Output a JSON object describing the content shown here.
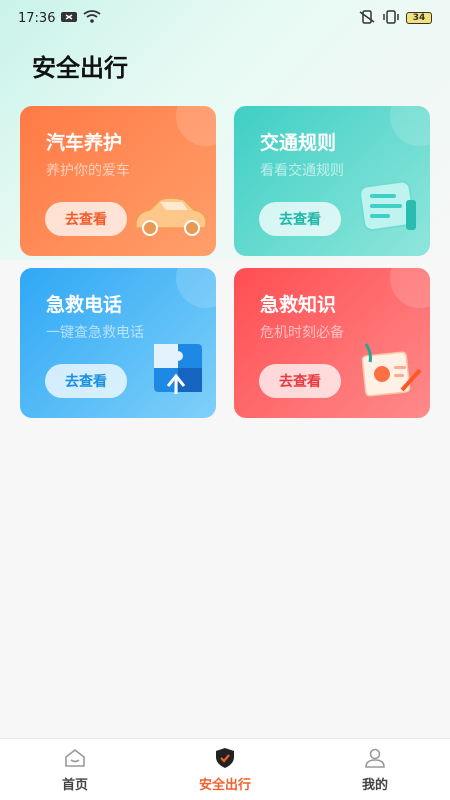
{
  "status_bar": {
    "time": "17:36",
    "battery": "34",
    "icons": [
      "notification-icon",
      "wifi-icon",
      "vibrate-off-icon",
      "vibrate-icon"
    ]
  },
  "page": {
    "title": "安全出行"
  },
  "cards": [
    {
      "title": "汽车养护",
      "subtitle": "养护你的爱车",
      "button": "去查看",
      "icon": "car-icon",
      "color": "#ff7a45"
    },
    {
      "title": "交通规则",
      "subtitle": "看看交通规则",
      "button": "去查看",
      "icon": "document-icon",
      "color": "#3fcfc4"
    },
    {
      "title": "急救电话",
      "subtitle": "一键查急救电话",
      "button": "去查看",
      "icon": "puzzle-icon",
      "color": "#2fa8f6"
    },
    {
      "title": "急救知识",
      "subtitle": "危机时刻必备",
      "button": "去查看",
      "icon": "clipboard-icon",
      "color": "#ff4e52"
    }
  ],
  "tabbar": {
    "items": [
      {
        "label": "首页",
        "icon": "home-icon",
        "active": false
      },
      {
        "label": "安全出行",
        "icon": "shield-check-icon",
        "active": true
      },
      {
        "label": "我的",
        "icon": "user-icon",
        "active": false
      }
    ],
    "active_color": "#f2622e"
  }
}
